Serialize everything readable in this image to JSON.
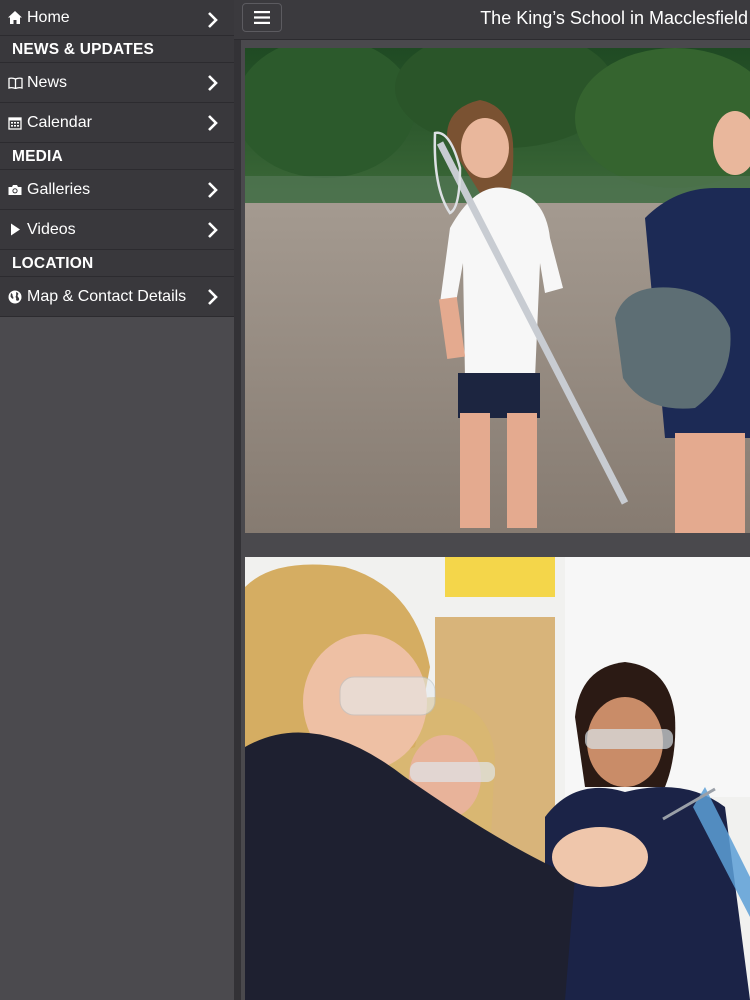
{
  "header": {
    "title": "The King’s School in Macclesfield",
    "menu_icon": "hamburger-menu-icon"
  },
  "sidebar": {
    "home": {
      "label": "Home",
      "icon": "home-icon"
    },
    "sections": [
      {
        "label": "NEWS & UPDATES"
      },
      {
        "label": "MEDIA"
      },
      {
        "label": "LOCATION"
      }
    ],
    "items": [
      {
        "label": "News",
        "icon": "book-icon"
      },
      {
        "label": "Calendar",
        "icon": "calendar-icon"
      },
      {
        "label": "Galleries",
        "icon": "camera-icon"
      },
      {
        "label": "Videos",
        "icon": "play-icon"
      },
      {
        "label": "Map & Contact Details",
        "icon": "globe-icon"
      }
    ]
  },
  "content": {
    "photos": [
      {
        "subject": "lacrosse-girls-photo"
      },
      {
        "subject": "science-lab-students-photo"
      }
    ]
  },
  "colors": {
    "sidebar_bg": "#39383c",
    "page_bg": "#4a494d",
    "text": "#ffffff"
  }
}
